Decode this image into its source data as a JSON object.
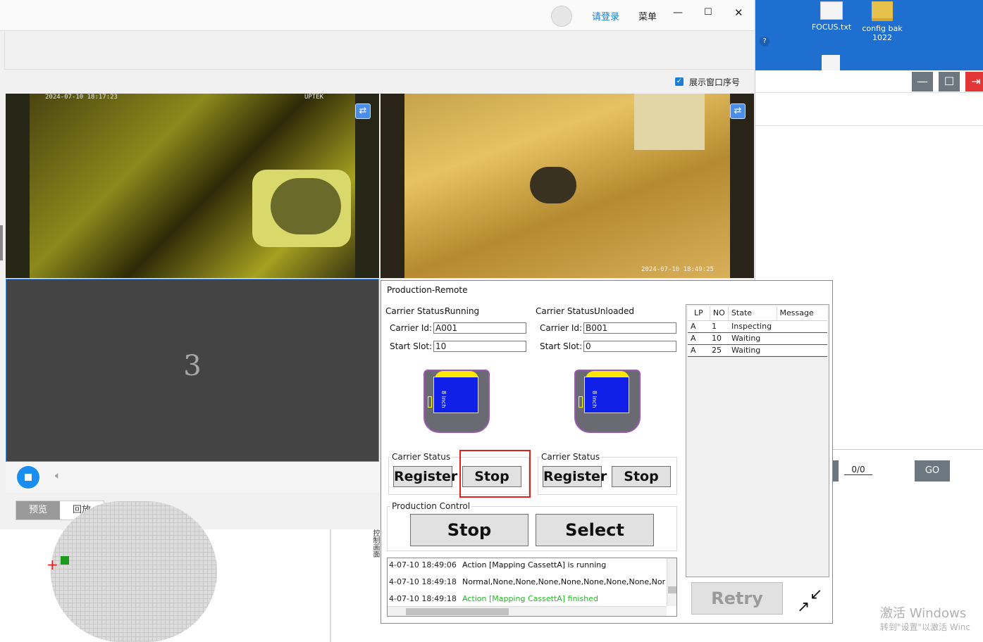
{
  "main_window": {
    "login_link": "请登录",
    "menu": "菜单",
    "show_window_index_label": "展示窗口序号",
    "camera_1_overlay": "2024-07-10 18:17:23",
    "camera_1_brand": "UPTEK",
    "camera_2_overlay": "2024-07-10 18:49:25",
    "camera_3_number": "3",
    "tabs": [
      "预览",
      "回放"
    ],
    "bottom_label": "控制画面"
  },
  "desktop": {
    "icons": [
      {
        "label": "FOCUS.txt",
        "icon": "text-file-icon"
      },
      {
        "label": "config bak\n1022",
        "icon": "folder-icon"
      }
    ]
  },
  "right_app": {
    "page_counter": "0/0",
    "go_button": "GO"
  },
  "dialog": {
    "title": "Production-Remote",
    "lp_a": {
      "status_label": "Carrier Status:",
      "status_value": "Running",
      "carrier_id_label": "Carrier Id:",
      "carrier_id_value": "A001",
      "start_slot_label": "Start Slot:",
      "start_slot_value": "10",
      "group_title": "Carrier Status",
      "register": "Register",
      "stop": "Stop",
      "cassette_text": "8 inch"
    },
    "lp_b": {
      "status_label": "Carrier Status:",
      "status_value": "Unloaded",
      "carrier_id_label": "Carrier Id:",
      "carrier_id_value": "B001",
      "start_slot_label": "Start Slot:",
      "start_slot_value": "0",
      "group_title": "Carrier Status",
      "register": "Register",
      "stop": "Stop",
      "cassette_text": "8 inch"
    },
    "production_control": {
      "title": "Production Control",
      "stop": "Stop",
      "select": "Select"
    },
    "grid": {
      "headers": [
        "LP",
        "NO",
        "State",
        "Message"
      ],
      "rows": [
        {
          "lp": "A",
          "no": "1",
          "state": "Inspecting",
          "message": ""
        },
        {
          "lp": "A",
          "no": "10",
          "state": "Waiting",
          "message": ""
        },
        {
          "lp": "A",
          "no": "25",
          "state": "Waiting",
          "message": ""
        }
      ]
    },
    "log": [
      {
        "time": "4-07-10 18:49:06",
        "message": "Action [Mapping CassettA] is running",
        "color": "#111111"
      },
      {
        "time": "4-07-10 18:49:18",
        "message": "Normal,None,None,None,None,None,None,None,Nor",
        "color": "#111111"
      },
      {
        "time": "4-07-10 18:49:18",
        "message": "Action [Mapping CassettA] finished",
        "color": "#22bb22"
      }
    ],
    "retry": "Retry"
  },
  "watermark": {
    "line1": "激活 Windows",
    "line2": "转到\"设置\"以激活 Winc"
  },
  "colors": {
    "accent": "#1a7fd4",
    "highlight": "#e02020",
    "log_success": "#22bb22"
  }
}
